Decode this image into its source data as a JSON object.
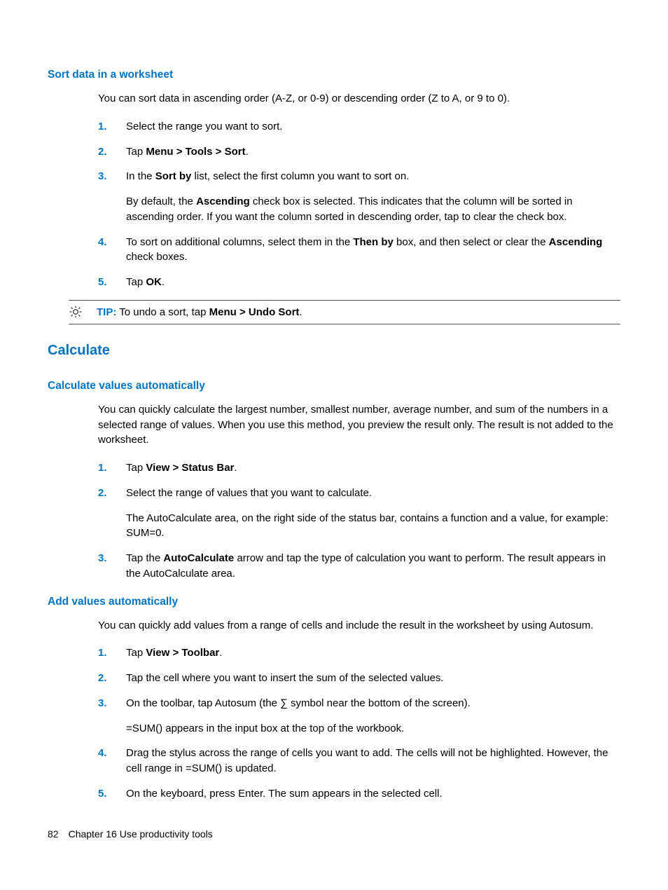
{
  "section1": {
    "heading": "Sort data in a worksheet",
    "intro": "You can sort data in ascending order (A-Z, or 0-9) or descending order (Z to A, or 9 to 0).",
    "steps": {
      "s1": "Select the range you want to sort.",
      "s2_pre": "Tap ",
      "s2_bold": "Menu > Tools > Sort",
      "s2_post": ".",
      "s3_pre": "In the ",
      "s3_bold": "Sort by",
      "s3_post": " list, select the first column you want to sort on.",
      "s3_sub_pre": "By default, the ",
      "s3_sub_bold": "Ascending",
      "s3_sub_post": " check box is selected. This indicates that the column will be sorted in ascending order. If you want the column sorted in descending order, tap to clear the check box.",
      "s4_pre": "To sort on additional columns, select them in the ",
      "s4_bold1": "Then by",
      "s4_mid": " box, and then select or clear the ",
      "s4_bold2": "Ascending",
      "s4_post": " check boxes.",
      "s5_pre": "Tap ",
      "s5_bold": "OK",
      "s5_post": "."
    },
    "tip": {
      "label": "TIP:",
      "pre": "  To undo a sort, tap ",
      "bold": "Menu > Undo Sort",
      "post": "."
    }
  },
  "section2": {
    "heading": "Calculate",
    "sub1": {
      "heading": "Calculate values automatically",
      "intro": "You can quickly calculate the largest number, smallest number, average number, and sum of the numbers in a selected range of values. When you use this method, you preview the result only. The result is not added to the worksheet.",
      "steps": {
        "s1_pre": "Tap ",
        "s1_bold": "View > Status Bar",
        "s1_post": ".",
        "s2": "Select the range of values that you want to calculate.",
        "s2_sub": "The AutoCalculate area, on the right side of the status bar, contains a function and a value, for example: SUM=0.",
        "s3_pre": "Tap the ",
        "s3_bold": "AutoCalculate",
        "s3_post": " arrow and tap the type of calculation you want to perform. The result appears in the AutoCalculate area."
      }
    },
    "sub2": {
      "heading": "Add values automatically",
      "intro": "You can quickly add values from a range of cells and include the result in the worksheet by using Autosum.",
      "steps": {
        "s1_pre": "Tap ",
        "s1_bold": "View > Toolbar",
        "s1_post": ".",
        "s2": "Tap the cell where you want to insert the sum of the selected values.",
        "s3": "On the toolbar, tap Autosum (the ∑ symbol near the bottom of the screen).",
        "s3_sub": "=SUM() appears in the input box at the top of the workbook.",
        "s4": "Drag the stylus across the range of cells you want to add. The cells will not be highlighted. However, the cell range in =SUM() is updated.",
        "s5": "On the keyboard, press Enter. The sum appears in the selected cell."
      }
    }
  },
  "footer": {
    "page": "82",
    "chapter": "Chapter 16   Use productivity tools"
  }
}
